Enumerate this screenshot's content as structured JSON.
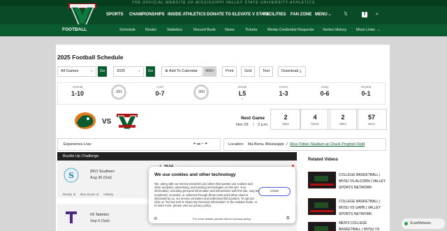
{
  "topbar": {
    "tagline": "THE OFFICIAL WEBSITE OF MISSISSIPPI VALLEY STATE UNIVERSITY ATHLETICS"
  },
  "mainnav": {
    "items": [
      "SPORTS",
      "CHAMPIONSHIPS",
      "INSIDE ATHLETICS",
      "DONATE TO ELEVATE V STATE",
      "FACILITIES",
      "FAN ZONE",
      "MENU"
    ],
    "icons": [
      "x-social-icon",
      "facebook-icon",
      "search-icon"
    ],
    "logo_letter": "V"
  },
  "subnav": {
    "sport": "FOOTBALL",
    "items": [
      "Schedule",
      "Roster",
      "Statistics",
      "Record Book",
      "News",
      "Tickets",
      "Media Credential Requests",
      "Series History",
      "More Links"
    ]
  },
  "page": {
    "title": "2025 Football Schedule"
  },
  "controls": {
    "filter_value": "All Games",
    "season_value": "2025",
    "go_label": "Go",
    "add_calendar": "Add To Calendar",
    "count": "400+",
    "print": "Print",
    "grid": "Grid",
    "text": "Text",
    "download": "Download"
  },
  "stats": {
    "overall": {
      "label": "Overall",
      "value": "1-10",
      "pct": ".091"
    },
    "conf": {
      "label": "Conf",
      "value": "0-7",
      "pct": ".000"
    },
    "streak": {
      "label": "Streak",
      "value": "L5"
    },
    "home": {
      "label": "Home",
      "value": "1-3"
    },
    "away": {
      "label": "Away",
      "value": "0-6"
    },
    "neutral": {
      "label": "Neutral",
      "value": "0-1"
    }
  },
  "matchup": {
    "vs": "VS",
    "next_title": "Next Game",
    "date": "Nov 29",
    "sep": "/",
    "time": "2 p.m.",
    "countdown": [
      {
        "num": "2",
        "unit": "days"
      },
      {
        "num": "4",
        "unit": "hours"
      },
      {
        "num": "2",
        "unit": "Mins"
      },
      {
        "num": "57",
        "unit": "Secs"
      }
    ]
  },
  "experience": {
    "label": "Experience Live:"
  },
  "location": {
    "label": "Location:",
    "city": "Itta Bena, Mississippi",
    "sep": "/",
    "venue": "Rice-Totten Stadium at Chuck Prophet Field"
  },
  "games": {
    "bucket_label": "Buckle Up Challenge",
    "game1": {
      "opponent": "(RV) Southern",
      "date": "Aug 30 (Sat)",
      "score": "L, 39-54",
      "links": [
        "Recap",
        "Box Score",
        "History"
      ]
    },
    "game2": {
      "opponent": "#3 Tarleton",
      "date": "Sep 6 (Sat)"
    }
  },
  "related": {
    "title": "Related Videos",
    "videos": [
      "COLLEGE BASKETBALL | MVSU VS ALCORN | VALLEY SPORTS NETWORK",
      "COLLEGE BASKETBALL | MVSU VS UAPB | VALLEY SPORTS NETWORK",
      "MEN'S COLLEGE BASKETBALL | MVSU VS A&M VALLEY"
    ]
  },
  "cookie": {
    "title": "We use cookies and other technology",
    "body": "We, along with our service providers and other third parties use cookies and other analytics, advertising, and tracking technologies on this site. Your information, including personal information and interactions with this site, may be monitored, recorded, or collected through these tools and further used or disclosed by us, our service providers and authorized third parties. To opt-out click on \"Do Not Sell or Share My Personal Information\" in the website footer, or to learn more, please visit our privacy policy.",
    "close": "Close",
    "footer": "For more details, please visit our privacy policy."
  },
  "scanmalware": {
    "label": "ScanMalware"
  },
  "colors": {
    "brand_green": "#0b5b30",
    "dark_green": "#063d1f",
    "accent_red": "#b01010"
  }
}
